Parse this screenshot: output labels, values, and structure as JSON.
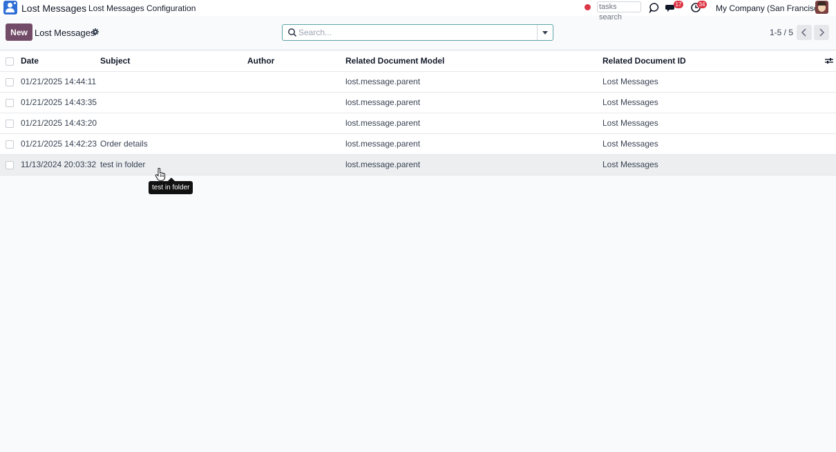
{
  "navbar": {
    "brand": "Lost Messages",
    "menu": [
      "Lost Messages",
      "Configuration"
    ],
    "tasks_search_placeholder": "tasks search",
    "messages_badge": "17",
    "activities_badge": "34",
    "company": "My Company (San Francisco)"
  },
  "control_panel": {
    "new_label": "New",
    "title": "Lost Messages",
    "search_placeholder": "Search...",
    "pager": "1-5 / 5"
  },
  "table": {
    "columns": [
      "Date",
      "Subject",
      "Author",
      "Related Document Model",
      "Related Document ID"
    ],
    "rows": [
      {
        "date": "01/21/2025 14:44:11",
        "subject": "",
        "author": "",
        "model": "lost.message.parent",
        "doc_id": "Lost Messages"
      },
      {
        "date": "01/21/2025 14:43:35",
        "subject": "",
        "author": "",
        "model": "lost.message.parent",
        "doc_id": "Lost Messages"
      },
      {
        "date": "01/21/2025 14:43:20",
        "subject": "",
        "author": "",
        "model": "lost.message.parent",
        "doc_id": "Lost Messages"
      },
      {
        "date": "01/21/2025 14:42:23",
        "subject": "Order details",
        "author": "",
        "model": "lost.message.parent",
        "doc_id": "Lost Messages"
      },
      {
        "date": "11/13/2024 20:03:32",
        "subject": "test in folder",
        "author": "",
        "model": "lost.message.parent",
        "doc_id": "Lost Messages"
      }
    ]
  },
  "tooltip": "test in folder",
  "colors": {
    "primary": "#714b67",
    "app_icon": "#2f6fd6",
    "badge": "#dc3545",
    "search_border": "#5ba3a6"
  },
  "icons": {
    "app": "user-app-icon",
    "recording": "record-dot-icon",
    "discuss": "chat-bubble-icon",
    "messages": "messages-icon",
    "activities": "clock-icon",
    "settings": "gear-icon",
    "search": "search-icon",
    "columns": "sliders-icon"
  }
}
